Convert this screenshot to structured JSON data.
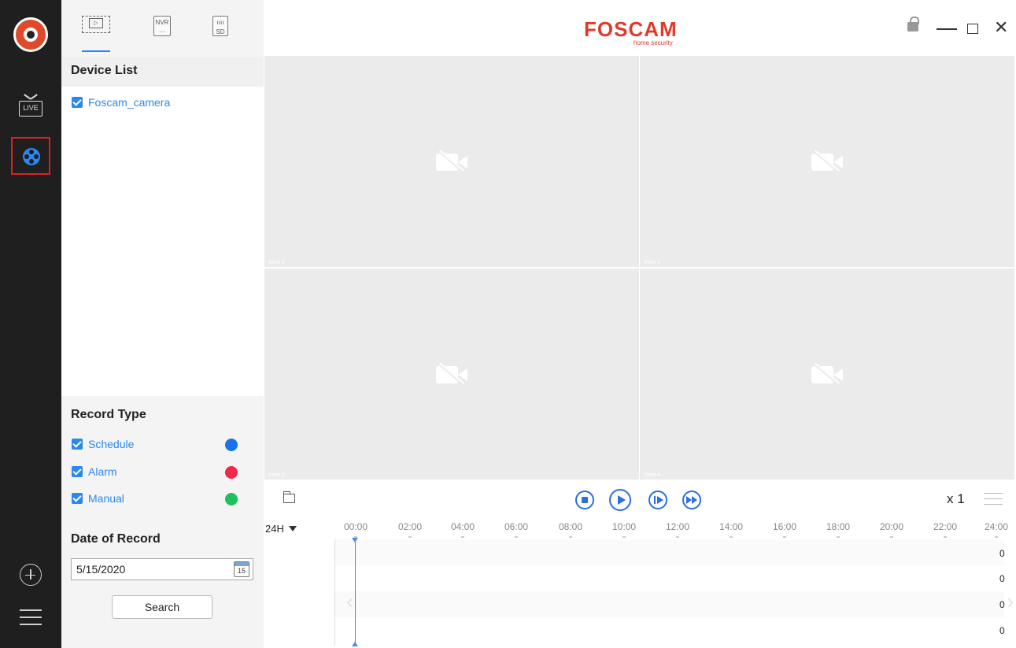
{
  "app": {
    "brand": "FOSCAM",
    "brand_sub": "home security"
  },
  "rail": {
    "items": [
      {
        "icon": "foscam-logo-icon"
      },
      {
        "icon": "live-tv-icon",
        "label": "LIVE"
      },
      {
        "icon": "film-reel-icon",
        "selected": true
      },
      {
        "icon": "add-circle-icon"
      },
      {
        "icon": "hamburger-menu-icon"
      }
    ]
  },
  "source_tabs": [
    {
      "icon": "monitor-play-icon",
      "active": true
    },
    {
      "icon": "nvr-icon",
      "label": "NVR"
    },
    {
      "icon": "sd-card-icon",
      "label": "SD"
    }
  ],
  "device_list": {
    "title": "Device List",
    "devices": [
      {
        "name": "Foscam_camera",
        "checked": true
      }
    ]
  },
  "record_type": {
    "title": "Record Type",
    "items": [
      {
        "label": "Schedule",
        "checked": true,
        "color": "#1a73e8"
      },
      {
        "label": "Alarm",
        "checked": true,
        "color": "#f0284a"
      },
      {
        "label": "Manual",
        "checked": true,
        "color": "#1fbf5f"
      }
    ]
  },
  "date_of_record": {
    "title": "Date of Record",
    "value": "5/15/2020",
    "calendar_day": "15",
    "search_label": "Search"
  },
  "views": [
    {
      "label": "View 1"
    },
    {
      "label": "View 2"
    },
    {
      "label": "View 3"
    },
    {
      "label": "View 4"
    }
  ],
  "playback": {
    "speed": "x 1"
  },
  "timeline": {
    "range": "24H",
    "ticks": [
      "00:00",
      "02:00",
      "04:00",
      "06:00",
      "08:00",
      "10:00",
      "12:00",
      "14:00",
      "16:00",
      "18:00",
      "20:00",
      "22:00",
      "24:00"
    ],
    "row_counts": [
      "0",
      "0",
      "0",
      "0"
    ]
  },
  "colors": {
    "accent": "#2b88f0",
    "brand": "#e03a2c",
    "highlight_border": "#e02020"
  }
}
